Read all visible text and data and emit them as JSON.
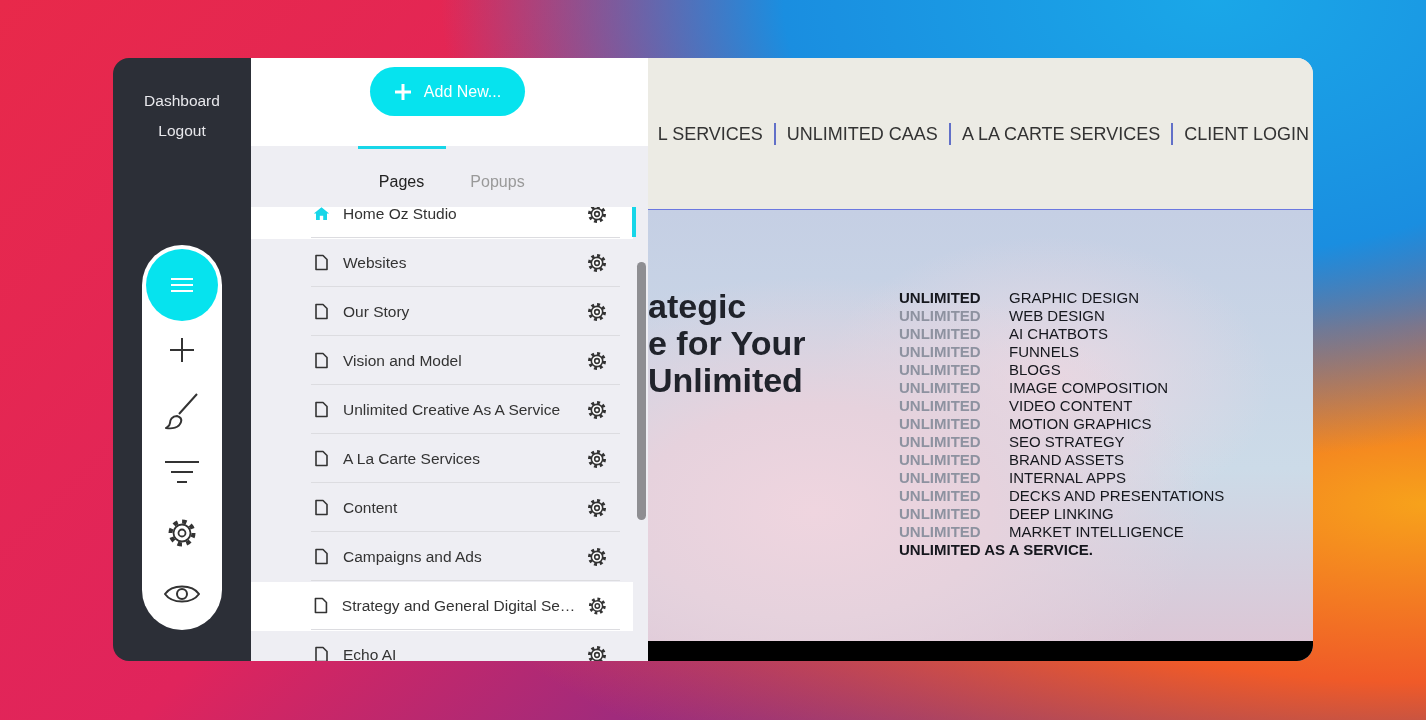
{
  "sidebar": {
    "links": [
      "Dashboard",
      "Logout"
    ],
    "tools": [
      {
        "kind": "menu",
        "selected": true
      },
      {
        "kind": "add",
        "selected": false
      },
      {
        "kind": "brush",
        "selected": false
      },
      {
        "kind": "filter",
        "selected": false
      },
      {
        "kind": "settings",
        "selected": false
      },
      {
        "kind": "view",
        "selected": false
      }
    ]
  },
  "pages_panel": {
    "add_button": "Add New...",
    "tabs": [
      {
        "label": "Pages",
        "selected": true
      },
      {
        "label": "Popups",
        "selected": false
      }
    ],
    "pages": [
      {
        "name": "Home Oz Studio",
        "kind": "home",
        "highlighted": true
      },
      {
        "name": "Websites",
        "kind": "page",
        "highlighted": false
      },
      {
        "name": "Our Story",
        "kind": "page",
        "highlighted": false
      },
      {
        "name": "Vision and Model",
        "kind": "page",
        "highlighted": false
      },
      {
        "name": "Unlimited Creative As A Service",
        "kind": "page",
        "highlighted": false
      },
      {
        "name": "A La Carte Services",
        "kind": "page",
        "highlighted": false
      },
      {
        "name": "Content",
        "kind": "page",
        "highlighted": false
      },
      {
        "name": "Campaigns and Ads",
        "kind": "page",
        "highlighted": false
      },
      {
        "name": "Strategy and General Digital Se…",
        "kind": "page",
        "highlighted": true
      },
      {
        "name": "Echo AI",
        "kind": "page",
        "highlighted": false
      }
    ]
  },
  "preview": {
    "nav": [
      "L SERVICES",
      "UNLIMITED CAAS",
      "A LA CARTE SERVICES",
      "CLIENT LOGIN"
    ],
    "headline": [
      "ategic",
      "e for Your",
      "Unlimited"
    ],
    "services": [
      {
        "prefix": "UNLIMITED",
        "prefix_faded": false,
        "label": "GRAPHIC DESIGN"
      },
      {
        "prefix": "UNLIMITED",
        "prefix_faded": true,
        "label": "WEB DESIGN"
      },
      {
        "prefix": "UNLIMITED",
        "prefix_faded": true,
        "label": "AI CHATBOTS"
      },
      {
        "prefix": "UNLIMITED",
        "prefix_faded": true,
        "label": "FUNNELS"
      },
      {
        "prefix": "UNLIMITED",
        "prefix_faded": true,
        "label": "BLOGS"
      },
      {
        "prefix": "UNLIMITED",
        "prefix_faded": true,
        "label": "IMAGE COMPOSITION"
      },
      {
        "prefix": "UNLIMITED",
        "prefix_faded": true,
        "label": "VIDEO CONTENT"
      },
      {
        "prefix": "UNLIMITED",
        "prefix_faded": true,
        "label": "MOTION GRAPHICS"
      },
      {
        "prefix": "UNLIMITED",
        "prefix_faded": true,
        "label": "SEO STRATEGY"
      },
      {
        "prefix": "UNLIMITED",
        "prefix_faded": true,
        "label": "BRAND ASSETS"
      },
      {
        "prefix": "UNLIMITED",
        "prefix_faded": true,
        "label": "INTERNAL APPS"
      },
      {
        "prefix": "UNLIMITED",
        "prefix_faded": true,
        "label": "DECKS AND PRESENTATIONS"
      },
      {
        "prefix": "UNLIMITED",
        "prefix_faded": true,
        "label": "DEEP LINKING"
      },
      {
        "prefix": "UNLIMITED",
        "prefix_faded": true,
        "label": "MARKET INTELLIGENCE"
      }
    ],
    "closing": "UNLIMITED AS A SERVICE."
  }
}
